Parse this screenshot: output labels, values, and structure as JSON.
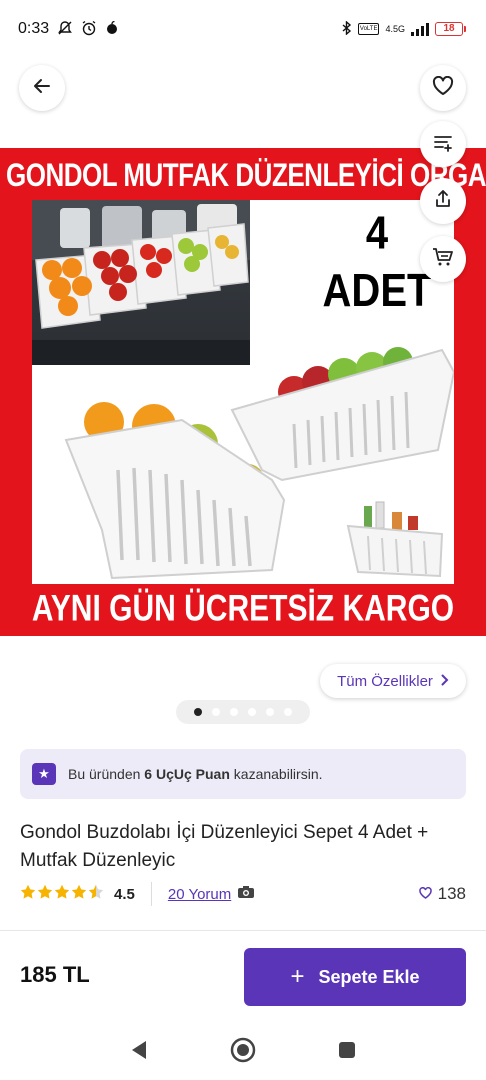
{
  "status_bar": {
    "time": "0:33",
    "network_label": "4.5G",
    "lte_label": "VoLTE",
    "battery": "18"
  },
  "product": {
    "banner_top": "GONDOL MUTFAK DÜZENLEYİCİ ORGANİZER",
    "banner_count": "4",
    "banner_count_unit": "ADET",
    "banner_bottom": "AYNI GÜN ÜCRETSİZ KARGO",
    "features_label": "Tüm Özellikler",
    "image_count": 6,
    "active_image": 1,
    "points_prefix": "Bu üründen ",
    "points_value": "6 UçUç Puan",
    "points_suffix": " kazanabilirsin.",
    "title": "Gondol Buzdolabı İçi Düzenleyici Sepet 4 Adet + Mutfak Düzenleyic",
    "rating": "4.5",
    "rating_fraction": 0.9,
    "reviews_label": "20 Yorum",
    "favorites": "138"
  },
  "bottom_bar": {
    "price": "185 TL",
    "add_label": "Sepete Ekle"
  },
  "icons": {
    "back": "arrow-left-icon",
    "favorite": "heart-icon",
    "filter": "filter-icon",
    "share": "share-icon",
    "cart": "cart-icon"
  },
  "colors": {
    "accent": "#5a35b8",
    "banner_red": "#e3141b",
    "star": "#f6b400",
    "points_bg": "#eeebf8"
  }
}
